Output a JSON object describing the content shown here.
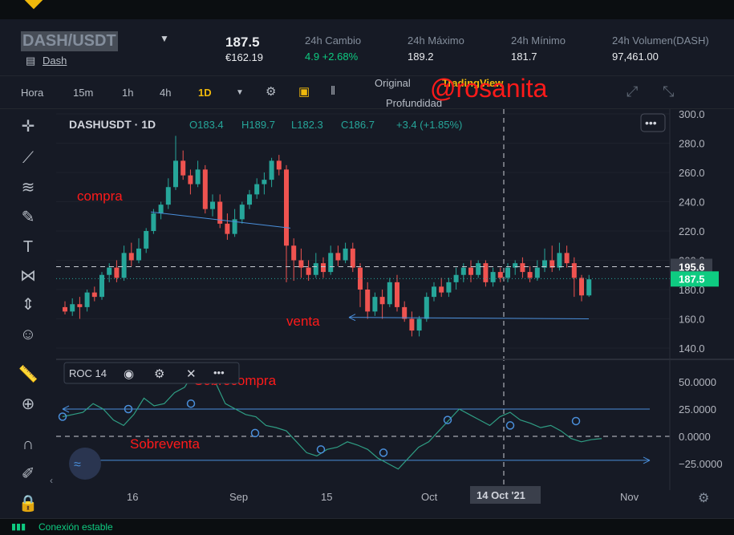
{
  "header": {
    "pair": "DASH/USDT",
    "coin": "Dash",
    "price": "187.5",
    "price_eur": "€162.19",
    "stats": [
      {
        "label": "24h Cambio",
        "value": "4.9 +2.68%",
        "positive": true
      },
      {
        "label": "24h Máximo",
        "value": "189.2"
      },
      {
        "label": "24h Mínimo",
        "value": "181.7"
      },
      {
        "label": "24h Volumen(DASH)",
        "value": "97,461.00"
      }
    ]
  },
  "toolbar": {
    "intervals": [
      "Hora",
      "15m",
      "1h",
      "4h",
      "1D"
    ],
    "active_interval": "1D",
    "views": [
      "Original",
      "TradingView",
      "Profundidad"
    ],
    "active_view": "TradingView",
    "watermark": "@rosanita"
  },
  "chart": {
    "symbol": "DASHUSDT · 1D",
    "ohlc": {
      "o": "O183.4",
      "h": "H189.7",
      "l": "L182.3",
      "c": "C186.7",
      "chg": "+3.4 (+1.85%)"
    },
    "price_ticks": [
      "300.0",
      "280.0",
      "260.0",
      "240.0",
      "220.0",
      "200.0",
      "180.0",
      "160.0",
      "140.0"
    ],
    "last_price_label": "187.5",
    "crosshair_price_label": "195.6",
    "crosshair_date_label": "14 Oct '21",
    "x_ticks": [
      "16",
      "Sep",
      "15",
      "Oct",
      "Nov"
    ],
    "annotations": {
      "buy": "compra",
      "sell": "venta",
      "overbought": "Sobrecompra",
      "oversold": "Sobreventa"
    },
    "colors": {
      "up": "#26a69a",
      "down": "#ef5350",
      "accent": "#f0b90b",
      "annotation": "#ff1a1a",
      "line": "#4a8fdb"
    }
  },
  "indicator": {
    "name": "ROC 14",
    "ticks": [
      "50.0000",
      "25.0000",
      "0.0000",
      "−25.0000"
    ]
  },
  "chart_data": {
    "type": "candlestick",
    "series": [
      {
        "name": "DASHUSDT",
        "values": [
          [
            168,
            165,
            172,
            163
          ],
          [
            165,
            170,
            174,
            162
          ],
          [
            170,
            168,
            175,
            160
          ],
          [
            168,
            178,
            180,
            165
          ],
          [
            178,
            175,
            182,
            172
          ],
          [
            175,
            190,
            192,
            173
          ],
          [
            190,
            195,
            198,
            185
          ],
          [
            195,
            188,
            200,
            185
          ],
          [
            188,
            205,
            210,
            186
          ],
          [
            205,
            200,
            212,
            196
          ],
          [
            200,
            208,
            215,
            198
          ],
          [
            208,
            220,
            222,
            205
          ],
          [
            220,
            232,
            235,
            218
          ],
          [
            232,
            238,
            240,
            228
          ],
          [
            238,
            250,
            256,
            235
          ],
          [
            250,
            268,
            285,
            248
          ],
          [
            268,
            258,
            275,
            255
          ],
          [
            258,
            252,
            262,
            245
          ],
          [
            252,
            262,
            268,
            250
          ],
          [
            262,
            235,
            265,
            232
          ],
          [
            235,
            240,
            245,
            230
          ],
          [
            240,
            225,
            245,
            222
          ],
          [
            225,
            218,
            232,
            214
          ],
          [
            218,
            228,
            235,
            216
          ],
          [
            228,
            238,
            240,
            225
          ],
          [
            238,
            245,
            248,
            235
          ],
          [
            245,
            252,
            256,
            242
          ],
          [
            252,
            255,
            260,
            245
          ],
          [
            255,
            268,
            270,
            250
          ],
          [
            268,
            262,
            272,
            258
          ],
          [
            262,
            210,
            265,
            185
          ],
          [
            210,
            200,
            215,
            186
          ],
          [
            200,
            195,
            208,
            188
          ],
          [
            195,
            190,
            200,
            186
          ],
          [
            190,
            198,
            205,
            188
          ],
          [
            198,
            192,
            202,
            188
          ],
          [
            192,
            205,
            210,
            190
          ],
          [
            205,
            200,
            210,
            196
          ],
          [
            200,
            208,
            212,
            198
          ],
          [
            208,
            195,
            212,
            192
          ],
          [
            195,
            180,
            198,
            168
          ],
          [
            180,
            165,
            185,
            160
          ],
          [
            165,
            175,
            178,
            162
          ],
          [
            175,
            170,
            180,
            160
          ],
          [
            170,
            185,
            188,
            168
          ],
          [
            185,
            168,
            190,
            165
          ],
          [
            168,
            160,
            172,
            158
          ],
          [
            160,
            152,
            165,
            148
          ],
          [
            152,
            160,
            162,
            148
          ],
          [
            160,
            175,
            178,
            158
          ],
          [
            175,
            182,
            185,
            172
          ],
          [
            182,
            178,
            188,
            175
          ],
          [
            178,
            185,
            188,
            175
          ],
          [
            185,
            190,
            195,
            180
          ],
          [
            190,
            195,
            198,
            185
          ],
          [
            195,
            190,
            200,
            185
          ],
          [
            190,
            198,
            200,
            188
          ],
          [
            198,
            185,
            200,
            182
          ],
          [
            185,
            192,
            195,
            182
          ],
          [
            192,
            188,
            195,
            185
          ],
          [
            188,
            195,
            198,
            185
          ],
          [
            195,
            198,
            200,
            190
          ],
          [
            198,
            192,
            202,
            188
          ],
          [
            192,
            188,
            196,
            185
          ],
          [
            188,
            195,
            200,
            186
          ],
          [
            195,
            200,
            208,
            192
          ],
          [
            200,
            195,
            210,
            192
          ],
          [
            195,
            205,
            212,
            193
          ],
          [
            205,
            198,
            210,
            195
          ],
          [
            198,
            188,
            202,
            175
          ],
          [
            188,
            176,
            190,
            172
          ],
          [
            176,
            187,
            190,
            175
          ]
        ]
      }
    ],
    "indicator_series": {
      "name": "ROC 14",
      "values": [
        18,
        20,
        22,
        30,
        25,
        15,
        10,
        20,
        35,
        28,
        30,
        40,
        45,
        60,
        55,
        50,
        30,
        25,
        20,
        18,
        10,
        8,
        5,
        -5,
        -15,
        -18,
        -12,
        -10,
        -5,
        -8,
        -12,
        -20,
        -25,
        -30,
        -20,
        -10,
        -5,
        5,
        15,
        25,
        20,
        15,
        10,
        18,
        22,
        15,
        12,
        8,
        10,
        5,
        -2,
        -5,
        -3,
        -2
      ]
    }
  },
  "status": {
    "text": "Conexión estable"
  }
}
